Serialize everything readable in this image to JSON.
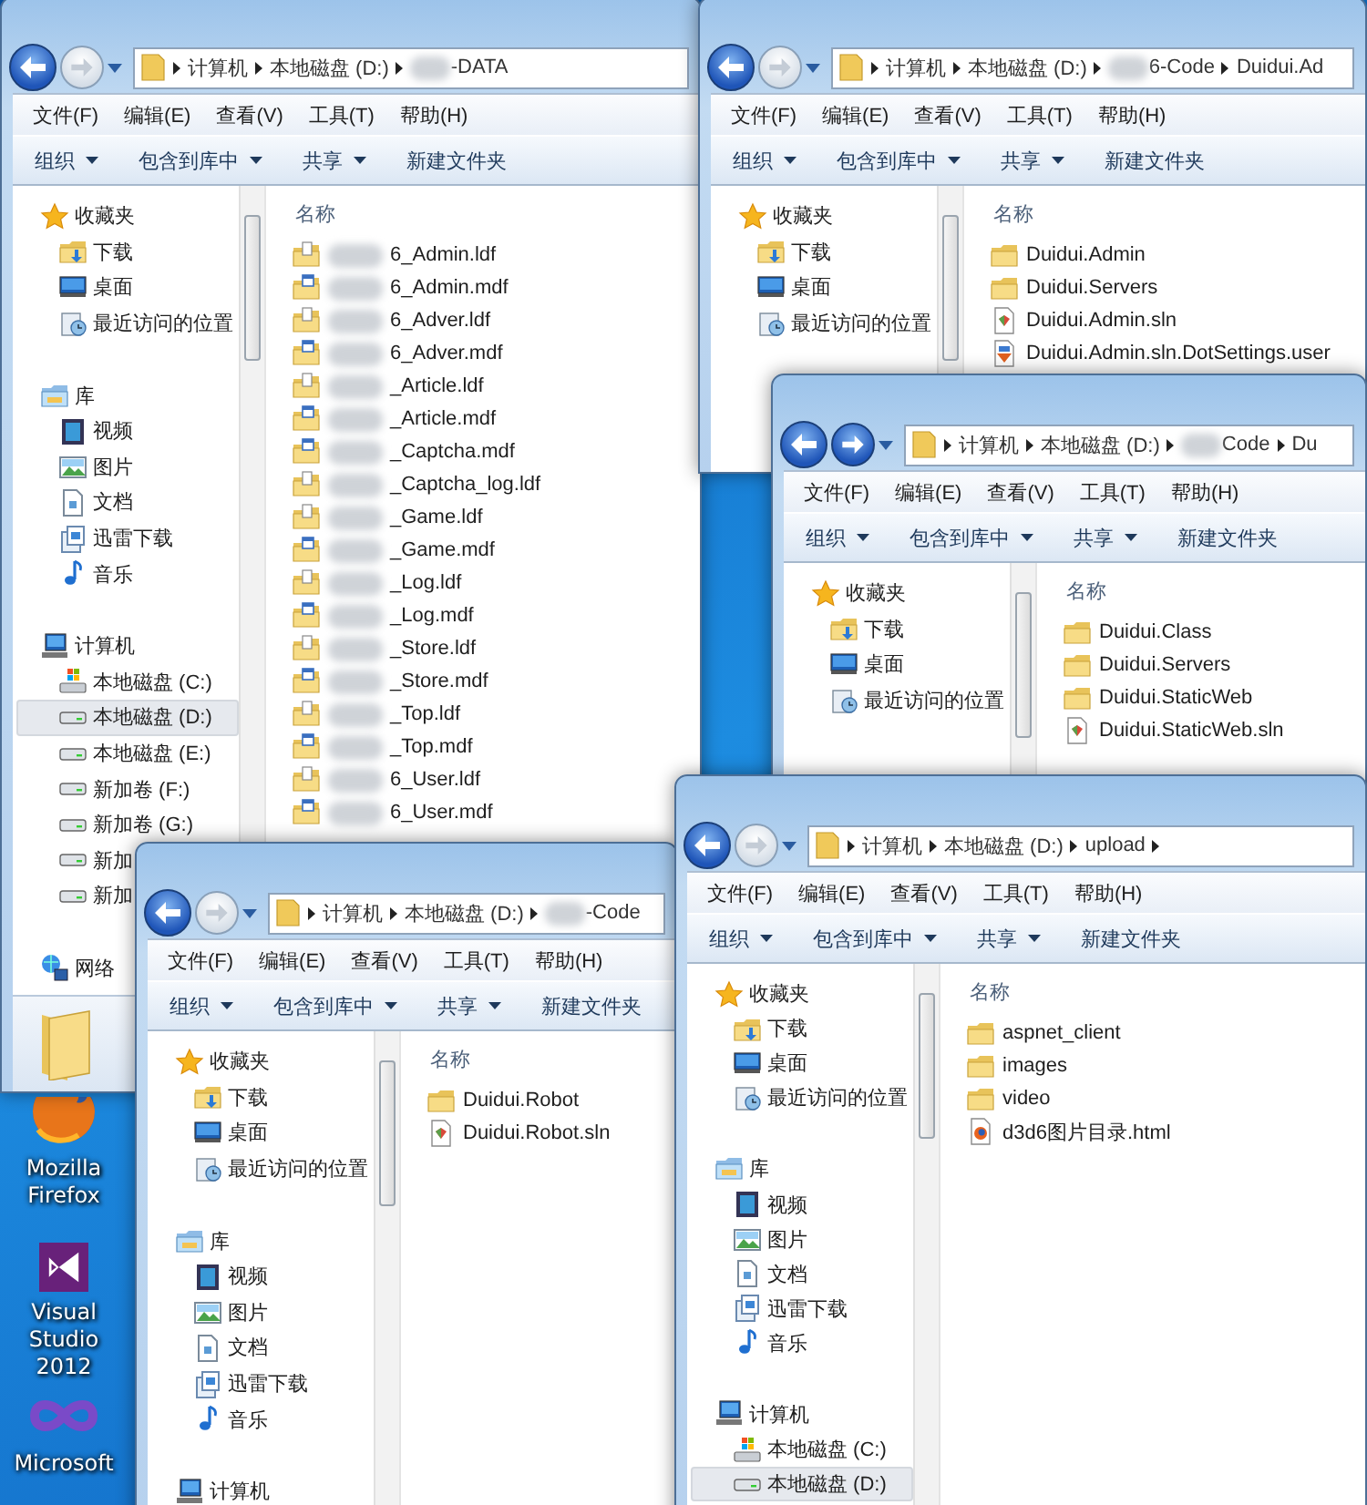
{
  "desktop": {
    "icons": [
      {
        "kind": "firefox",
        "label": "Mozilla Firefox"
      },
      {
        "kind": "visual-studio",
        "label": "Visual Studio 2012"
      },
      {
        "kind": "visual-studio-old",
        "label": "Microsoft"
      }
    ]
  },
  "windows": [
    {
      "forward_enabled": false,
      "trailing_arrow": false,
      "details_pane": true,
      "path": [
        {
          "text": "计算机",
          "redacted": false
        },
        {
          "text": "本地磁盘 (D:)",
          "redacted": false
        },
        {
          "text": "-DATA",
          "redacted": true
        }
      ],
      "menu": [
        "文件(F)",
        "编辑(E)",
        "查看(V)",
        "工具(T)",
        "帮助(H)"
      ],
      "toolbar": [
        {
          "label": "组织",
          "dropdown": true
        },
        {
          "label": "包含到库中",
          "dropdown": true
        },
        {
          "label": "共享",
          "dropdown": true
        },
        {
          "label": "新建文件夹",
          "dropdown": false
        }
      ],
      "nav": [
        {
          "kind": "favorites",
          "label": "收藏夹",
          "selected": false
        },
        {
          "kind": "downloads",
          "label": "下载",
          "selected": false
        },
        {
          "kind": "desktop",
          "label": "桌面",
          "selected": false
        },
        {
          "kind": "recent",
          "label": "最近访问的位置",
          "selected": false
        },
        {
          "kind": "library",
          "label": "库",
          "selected": false
        },
        {
          "kind": "videos",
          "label": "视频",
          "selected": false
        },
        {
          "kind": "pictures",
          "label": "图片",
          "selected": false
        },
        {
          "kind": "documents",
          "label": "文档",
          "selected": false
        },
        {
          "kind": "thunder",
          "label": "迅雷下载",
          "selected": false
        },
        {
          "kind": "music",
          "label": "音乐",
          "selected": false
        },
        {
          "kind": "computer",
          "label": "计算机",
          "selected": false
        },
        {
          "kind": "system-drive",
          "label": "本地磁盘 (C:)",
          "selected": false
        },
        {
          "kind": "drive",
          "label": "本地磁盘 (D:)",
          "selected": true
        },
        {
          "kind": "drive",
          "label": "本地磁盘 (E:)",
          "selected": false
        },
        {
          "kind": "drive",
          "label": "新加卷 (F:)",
          "selected": false
        },
        {
          "kind": "drive",
          "label": "新加卷 (G:)",
          "selected": false
        },
        {
          "kind": "drive",
          "label": "新加",
          "selected": false
        },
        {
          "kind": "drive",
          "label": "新加",
          "selected": false
        },
        {
          "kind": "network",
          "label": "网络",
          "selected": false
        }
      ],
      "column_header": "名称",
      "files": [
        {
          "kind": "ldf",
          "name": "6_Admin.ldf",
          "redacted": true
        },
        {
          "kind": "mdf",
          "name": "6_Admin.mdf",
          "redacted": true
        },
        {
          "kind": "ldf",
          "name": "6_Adver.ldf",
          "redacted": true
        },
        {
          "kind": "mdf",
          "name": "6_Adver.mdf",
          "redacted": true
        },
        {
          "kind": "ldf",
          "name": "_Article.ldf",
          "redacted": true
        },
        {
          "kind": "mdf",
          "name": "_Article.mdf",
          "redacted": true
        },
        {
          "kind": "mdf",
          "name": "_Captcha.mdf",
          "redacted": true
        },
        {
          "kind": "ldf",
          "name": "_Captcha_log.ldf",
          "redacted": true
        },
        {
          "kind": "ldf",
          "name": "_Game.ldf",
          "redacted": true
        },
        {
          "kind": "mdf",
          "name": "_Game.mdf",
          "redacted": true
        },
        {
          "kind": "ldf",
          "name": "_Log.ldf",
          "redacted": true
        },
        {
          "kind": "mdf",
          "name": "_Log.mdf",
          "redacted": true
        },
        {
          "kind": "ldf",
          "name": "_Store.ldf",
          "redacted": true
        },
        {
          "kind": "mdf",
          "name": "_Store.mdf",
          "redacted": true
        },
        {
          "kind": "ldf",
          "name": "_Top.ldf",
          "redacted": true
        },
        {
          "kind": "mdf",
          "name": "_Top.mdf",
          "redacted": true
        },
        {
          "kind": "ldf",
          "name": "6_User.ldf",
          "redacted": true
        },
        {
          "kind": "mdf",
          "name": "6_User.mdf",
          "redacted": true
        }
      ]
    },
    {
      "forward_enabled": false,
      "trailing_arrow": false,
      "details_pane": false,
      "path": [
        {
          "text": "计算机",
          "redacted": false
        },
        {
          "text": "本地磁盘 (D:)",
          "redacted": false
        },
        {
          "text": "6-Code",
          "redacted": true
        },
        {
          "text": "Duidui.Ad",
          "redacted": false
        }
      ],
      "menu": [
        "文件(F)",
        "编辑(E)",
        "查看(V)",
        "工具(T)",
        "帮助(H)"
      ],
      "toolbar": [
        {
          "label": "组织",
          "dropdown": true
        },
        {
          "label": "包含到库中",
          "dropdown": true
        },
        {
          "label": "共享",
          "dropdown": true
        },
        {
          "label": "新建文件夹",
          "dropdown": false
        }
      ],
      "nav": [
        {
          "kind": "favorites",
          "label": "收藏夹",
          "selected": false
        },
        {
          "kind": "downloads",
          "label": "下载",
          "selected": false
        },
        {
          "kind": "desktop",
          "label": "桌面",
          "selected": false
        },
        {
          "kind": "recent",
          "label": "最近访问的位置",
          "selected": false
        }
      ],
      "column_header": "名称",
      "files": [
        {
          "kind": "folder",
          "name": "Duidui.Admin",
          "redacted": false
        },
        {
          "kind": "folder",
          "name": "Duidui.Servers",
          "redacted": false
        },
        {
          "kind": "sln",
          "name": "Duidui.Admin.sln",
          "redacted": false
        },
        {
          "kind": "settings",
          "name": "Duidui.Admin.sln.DotSettings.user",
          "redacted": false
        }
      ]
    },
    {
      "forward_enabled": true,
      "trailing_arrow": false,
      "details_pane": false,
      "path": [
        {
          "text": "计算机",
          "redacted": false
        },
        {
          "text": "本地磁盘 (D:)",
          "redacted": false
        },
        {
          "text": "Code",
          "redacted": true
        },
        {
          "text": "Du",
          "redacted": false
        }
      ],
      "menu": [
        "文件(F)",
        "编辑(E)",
        "查看(V)",
        "工具(T)",
        "帮助(H)"
      ],
      "toolbar": [
        {
          "label": "组织",
          "dropdown": true
        },
        {
          "label": "包含到库中",
          "dropdown": true
        },
        {
          "label": "共享",
          "dropdown": true
        },
        {
          "label": "新建文件夹",
          "dropdown": false
        }
      ],
      "nav": [
        {
          "kind": "favorites",
          "label": "收藏夹",
          "selected": false
        },
        {
          "kind": "downloads",
          "label": "下载",
          "selected": false
        },
        {
          "kind": "desktop",
          "label": "桌面",
          "selected": false
        },
        {
          "kind": "recent",
          "label": "最近访问的位置",
          "selected": false
        }
      ],
      "column_header": "名称",
      "files": [
        {
          "kind": "folder",
          "name": "Duidui.Class",
          "redacted": false
        },
        {
          "kind": "folder",
          "name": "Duidui.Servers",
          "redacted": false
        },
        {
          "kind": "folder",
          "name": "Duidui.StaticWeb",
          "redacted": false
        },
        {
          "kind": "sln",
          "name": "Duidui.StaticWeb.sln",
          "redacted": false
        }
      ]
    },
    {
      "forward_enabled": false,
      "trailing_arrow": false,
      "details_pane": false,
      "path": [
        {
          "text": "计算机",
          "redacted": false
        },
        {
          "text": "本地磁盘 (D:)",
          "redacted": false
        },
        {
          "text": "-Code",
          "redacted": true
        }
      ],
      "menu": [
        "文件(F)",
        "编辑(E)",
        "查看(V)",
        "工具(T)",
        "帮助(H)"
      ],
      "toolbar": [
        {
          "label": "组织",
          "dropdown": true
        },
        {
          "label": "包含到库中",
          "dropdown": true
        },
        {
          "label": "共享",
          "dropdown": true
        },
        {
          "label": "新建文件夹",
          "dropdown": false
        }
      ],
      "nav": [
        {
          "kind": "favorites",
          "label": "收藏夹",
          "selected": false
        },
        {
          "kind": "downloads",
          "label": "下载",
          "selected": false
        },
        {
          "kind": "desktop",
          "label": "桌面",
          "selected": false
        },
        {
          "kind": "recent",
          "label": "最近访问的位置",
          "selected": false
        },
        {
          "kind": "library",
          "label": "库",
          "selected": false
        },
        {
          "kind": "videos",
          "label": "视频",
          "selected": false
        },
        {
          "kind": "pictures",
          "label": "图片",
          "selected": false
        },
        {
          "kind": "documents",
          "label": "文档",
          "selected": false
        },
        {
          "kind": "thunder",
          "label": "迅雷下载",
          "selected": false
        },
        {
          "kind": "music",
          "label": "音乐",
          "selected": false
        },
        {
          "kind": "computer",
          "label": "计算机",
          "selected": false
        }
      ],
      "column_header": "名称",
      "files": [
        {
          "kind": "folder",
          "name": "Duidui.Robot",
          "redacted": false
        },
        {
          "kind": "sln",
          "name": "Duidui.Robot.sln",
          "redacted": false
        }
      ]
    },
    {
      "forward_enabled": false,
      "trailing_arrow": true,
      "details_pane": false,
      "path": [
        {
          "text": "计算机",
          "redacted": false
        },
        {
          "text": "本地磁盘 (D:)",
          "redacted": false
        },
        {
          "text": "upload",
          "redacted": false
        }
      ],
      "menu": [
        "文件(F)",
        "编辑(E)",
        "查看(V)",
        "工具(T)",
        "帮助(H)"
      ],
      "toolbar": [
        {
          "label": "组织",
          "dropdown": true
        },
        {
          "label": "包含到库中",
          "dropdown": true
        },
        {
          "label": "共享",
          "dropdown": true
        },
        {
          "label": "新建文件夹",
          "dropdown": false
        }
      ],
      "nav": [
        {
          "kind": "favorites",
          "label": "收藏夹",
          "selected": false
        },
        {
          "kind": "downloads",
          "label": "下载",
          "selected": false
        },
        {
          "kind": "desktop",
          "label": "桌面",
          "selected": false
        },
        {
          "kind": "recent",
          "label": "最近访问的位置",
          "selected": false
        },
        {
          "kind": "library",
          "label": "库",
          "selected": false
        },
        {
          "kind": "videos",
          "label": "视频",
          "selected": false
        },
        {
          "kind": "pictures",
          "label": "图片",
          "selected": false
        },
        {
          "kind": "documents",
          "label": "文档",
          "selected": false
        },
        {
          "kind": "thunder",
          "label": "迅雷下载",
          "selected": false
        },
        {
          "kind": "music",
          "label": "音乐",
          "selected": false
        },
        {
          "kind": "computer",
          "label": "计算机",
          "selected": false
        },
        {
          "kind": "system-drive",
          "label": "本地磁盘 (C:)",
          "selected": false
        },
        {
          "kind": "drive",
          "label": "本地磁盘 (D:)",
          "selected": true
        }
      ],
      "column_header": "名称",
      "files": [
        {
          "kind": "folder",
          "name": "aspnet_client",
          "redacted": false
        },
        {
          "kind": "folder",
          "name": "images",
          "redacted": false
        },
        {
          "kind": "folder",
          "name": "video",
          "redacted": false
        },
        {
          "kind": "html",
          "name": "d3d6图片目录.html",
          "redacted": false
        }
      ]
    }
  ]
}
